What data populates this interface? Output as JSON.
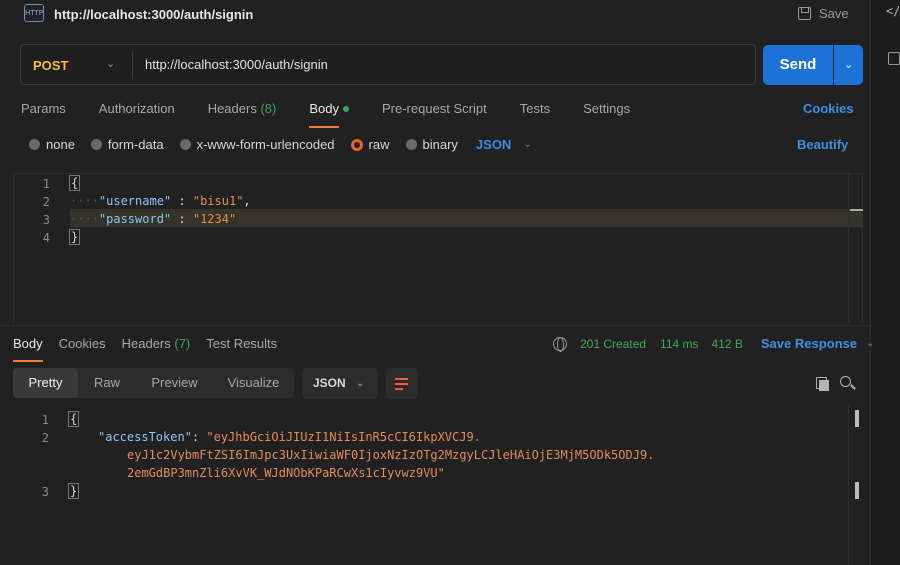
{
  "window": {
    "title": "http://localhost:3000/auth/signin",
    "http_icon_text": "HTTP",
    "save_label": "Save",
    "rail_code_icon": "</>"
  },
  "request": {
    "method": "POST",
    "url": "http://localhost:3000/auth/signin",
    "send_label": "Send",
    "tabs": {
      "params": "Params",
      "authorization": "Authorization",
      "headers": "Headers",
      "headers_count": "(8)",
      "body": "Body",
      "prerequest": "Pre-request Script",
      "tests": "Tests",
      "settings": "Settings"
    },
    "cookies_label": "Cookies",
    "body_types": {
      "none": "none",
      "form_data": "form-data",
      "urlencoded": "x-www-form-urlencoded",
      "raw": "raw",
      "binary": "binary",
      "selected": "raw"
    },
    "content_type": "JSON",
    "beautify_label": "Beautify",
    "line_numbers": [
      "1",
      "2",
      "3",
      "4"
    ],
    "body_lines": {
      "open": "{",
      "username_key": "\"username\"",
      "username_sep": " : ",
      "username_value": "\"bisu1\"",
      "username_comma": ",",
      "password_key": "\"password\"",
      "password_sep": " : ",
      "password_value": "\"1234\"",
      "close": "}"
    }
  },
  "response": {
    "tabs": {
      "body": "Body",
      "cookies": "Cookies",
      "headers": "Headers",
      "headers_count": "(7)",
      "test_results": "Test Results"
    },
    "status": "201 Created",
    "time": "114 ms",
    "size": "412 B",
    "save_response_label": "Save Response",
    "views": {
      "pretty": "Pretty",
      "raw": "Raw",
      "preview": "Preview",
      "visualize": "Visualize"
    },
    "format": "JSON",
    "line_numbers": [
      "1",
      "2",
      "3"
    ],
    "body": {
      "open": "{",
      "key": "\"accessToken\"",
      "sep": ": ",
      "token_line1": "\"eyJhbGciOiJIUzI1NiIsInR5cCI6IkpXVCJ9.",
      "token_line2": "eyJ1c2VybmFtZSI6ImJpc3UxIiwiaWF0IjoxNzIzOTg2MzgyLCJleHAiOjE3MjM5ODk5ODJ9.",
      "token_line3": "2emGdBP3mnZli6XvVK_WJdNObKPaRCwXs1cIyvwz9VU\"",
      "close": "}"
    }
  },
  "colors": {
    "accent_orange": "#f17a3e",
    "method_yellow": "#f2c23b",
    "link_blue": "#3d8fe3",
    "send_blue": "#1d74d6",
    "success_green": "#3cab5a"
  },
  "icons": {
    "save": "floppy-disk-icon",
    "globe": "globe-icon",
    "copy": "copy-icon",
    "search": "search-icon",
    "wrap": "wrap-lines-icon"
  }
}
